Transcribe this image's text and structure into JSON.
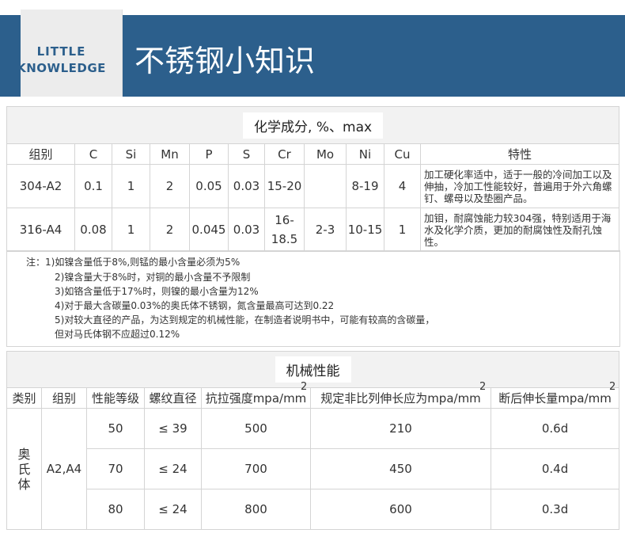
{
  "banner": {
    "badge_line1": "LITTLE",
    "badge_line2": "KNOWLEDGE",
    "title": "不锈钢小知识"
  },
  "composition": {
    "title": "化学成分, %、max",
    "headers": [
      "组别",
      "C",
      "Si",
      "Mn",
      "P",
      "S",
      "Cr",
      "Mo",
      "Ni",
      "Cu",
      "特性"
    ],
    "rows": [
      {
        "group": "304-A2",
        "c": "0.1",
        "si": "1",
        "mn": "2",
        "p": "0.05",
        "s": "0.03",
        "cr": "15-20",
        "mo": "",
        "ni": "8-19",
        "cu": "4",
        "trait": "加工硬化率适中，适于一般的冷间加工以及伸抽，冷加工性能较好，普遍用于外六角螺钉、螺母以及垫圈产品。"
      },
      {
        "group": "316-A4",
        "c": "0.08",
        "si": "1",
        "mn": "2",
        "p": "0.045",
        "s": "0.03",
        "cr_line1": "16-",
        "cr_line2": "18.5",
        "mo": "2-3",
        "ni": "10-15",
        "cu": "1",
        "trait": "加钼，耐腐蚀能力较304强，特别适用于海水及化学介质，更加的耐腐蚀性及耐孔蚀性。"
      }
    ],
    "notes": {
      "prefix": "注：",
      "items": [
        "1)如镍含量低于8%,则锰的最小含量必须为5%",
        "2)镍含量大于8%时，对铜的最小含量不予限制",
        "3)如铬含量低于17%时，则镍的最小含量为12%",
        "4)对于最大含碳量0.03%的奥氏体不锈钢，氮含量最高可达到0.22",
        "5)对较大直径的产品，为达到规定的机械性能，在制造者说明书中，可能有较高的含碳量，",
        "但对马氏体钢不应超过0.12%"
      ]
    }
  },
  "mechanical": {
    "title": "机械性能",
    "headers": [
      "类别",
      "组别",
      "性能等级",
      "螺纹直径",
      "抗拉强度mpa/mm",
      "规定非比列伸长应为mpa/mm",
      "断后伸长量mpa/mm"
    ],
    "superscript": "2",
    "category": "奥氏体",
    "group": "A2,A4",
    "rows": [
      {
        "grade": "50",
        "diameter": "≤ 39",
        "tensile": "500",
        "proof": "210",
        "elongation": "0.6d"
      },
      {
        "grade": "70",
        "diameter": "≤ 24",
        "tensile": "700",
        "proof": "450",
        "elongation": "0.4d"
      },
      {
        "grade": "80",
        "diameter": "≤ 24",
        "tensile": "800",
        "proof": "600",
        "elongation": "0.3d"
      }
    ]
  }
}
